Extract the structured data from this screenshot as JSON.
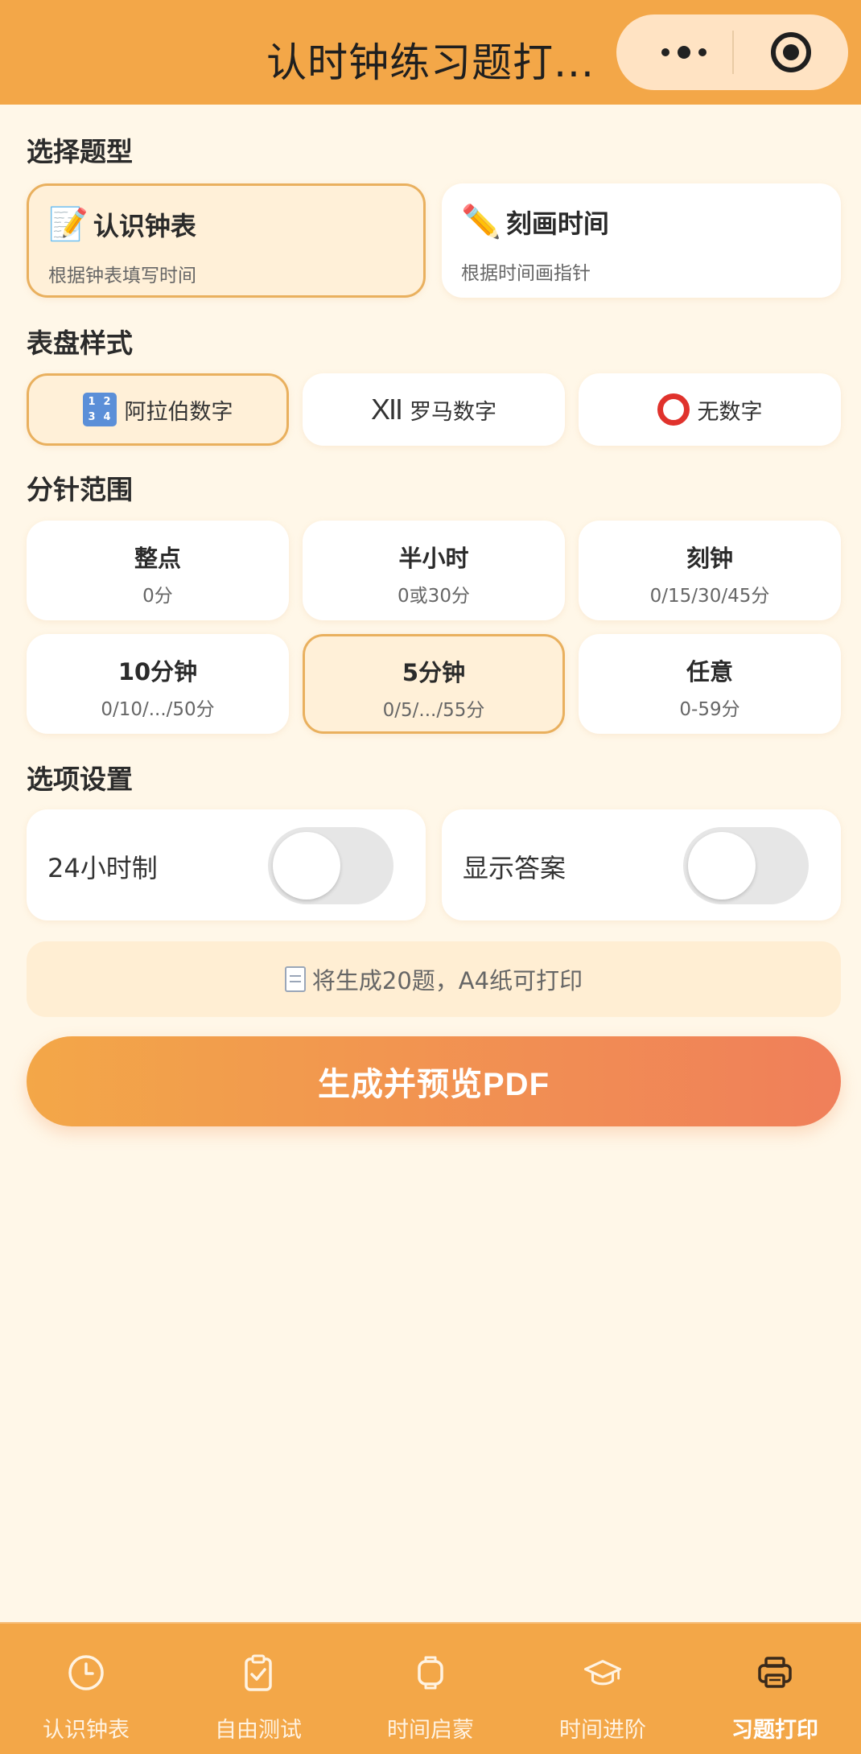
{
  "header": {
    "title": "认时钟练习题打...",
    "more_icon": "more-dots-icon",
    "close_icon": "target-icon"
  },
  "question_type": {
    "title": "选择题型",
    "options": [
      {
        "name": "认识钟表",
        "desc": "根据钟表填写时间",
        "icon": "memo-icon",
        "selected": true
      },
      {
        "name": "刻画时间",
        "desc": "根据时间画指针",
        "icon": "pencil-icon",
        "selected": false
      }
    ]
  },
  "dial_style": {
    "title": "表盘样式",
    "options": [
      {
        "label": "阿拉伯数字",
        "icon": "numbers-icon",
        "selected": true
      },
      {
        "label": "罗马数字",
        "icon": "roman-numeral-icon",
        "icon_text": "XII",
        "selected": false
      },
      {
        "label": "无数字",
        "icon": "circle-icon",
        "selected": false
      }
    ]
  },
  "minute_range": {
    "title": "分针范围",
    "options": [
      {
        "title": "整点",
        "sub": "0分",
        "selected": false
      },
      {
        "title": "半小时",
        "sub": "0或30分",
        "selected": false
      },
      {
        "title": "刻钟",
        "sub": "0/15/30/45分",
        "selected": false
      },
      {
        "title": "10分钟",
        "sub": "0/10/.../50分",
        "selected": false
      },
      {
        "title": "5分钟",
        "sub": "0/5/.../55分",
        "selected": true
      },
      {
        "title": "任意",
        "sub": "0-59分",
        "selected": false
      }
    ]
  },
  "settings": {
    "title": "选项设置",
    "options": [
      {
        "label": "24小时制",
        "enabled": false
      },
      {
        "label": "显示答案",
        "enabled": false
      }
    ]
  },
  "notice": {
    "icon": "document-icon",
    "text": "将生成20题，A4纸可打印"
  },
  "primary_button": {
    "label": "生成并预览PDF"
  },
  "tabbar": {
    "items": [
      {
        "label": "认识钟表",
        "icon": "clock-icon",
        "active": false
      },
      {
        "label": "自由测试",
        "icon": "clipboard-check-icon",
        "active": false
      },
      {
        "label": "时间启蒙",
        "icon": "watch-icon",
        "active": false
      },
      {
        "label": "时间进阶",
        "icon": "graduation-cap-icon",
        "active": false
      },
      {
        "label": "习题打印",
        "icon": "printer-icon",
        "active": true
      }
    ]
  },
  "colors": {
    "accent": "#F3A748",
    "gradient_end": "#F07F5A",
    "background": "#FFF7E8",
    "selected_fill": "#FFF0D8",
    "selected_border": "#E9B05E"
  }
}
